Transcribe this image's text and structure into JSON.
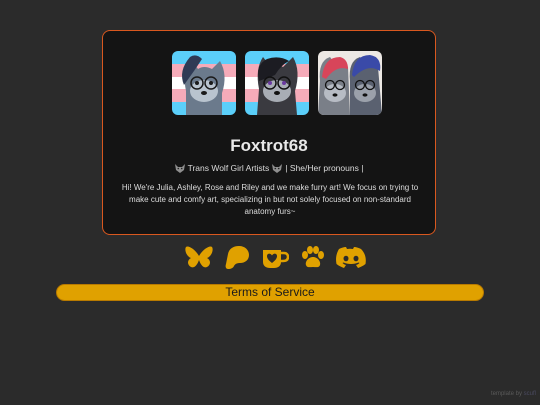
{
  "profile": {
    "name": "Foxtrot68",
    "tagline_left": "Trans Wolf Girl Artists",
    "tagline_right": "| She/Her pronouns |",
    "bio": "Hi! We're Julia, Ashley, Rose and Riley and we make furry art! We focus on trying to make cute and comfy art, specializing in but not solely focused on non-standard anatomy furs~"
  },
  "avatars": [
    {
      "icon": "wolf-avatar-icon",
      "flag": "trans"
    },
    {
      "icon": "wolf-avatar-icon",
      "flag": "trans"
    },
    {
      "icon": "wolf-pair-avatar-icon",
      "flag": "none"
    }
  ],
  "socials": [
    {
      "icon": "butterfly-icon"
    },
    {
      "icon": "paw-blob-icon"
    },
    {
      "icon": "mug-heart-icon"
    },
    {
      "icon": "paw-icon"
    },
    {
      "icon": "discord-icon"
    }
  ],
  "tos": {
    "label": "Terms of Service"
  },
  "footer": {
    "prefix": "template by",
    "link": "scufl"
  },
  "colors": {
    "background": "#2b2b2b",
    "card": "#141414",
    "card_border": "#d9581f",
    "accent": "#e0a100",
    "trans_blue": "#5bcffa",
    "trans_pink": "#f5abb9"
  }
}
